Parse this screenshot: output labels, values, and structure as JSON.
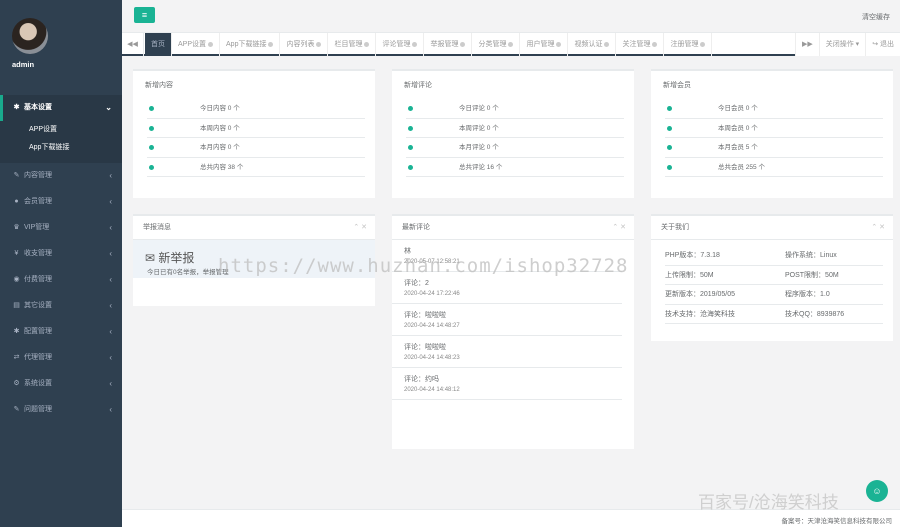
{
  "sidebar": {
    "username": "admin",
    "items": [
      {
        "icon": "gear-icon",
        "glyph": "✱",
        "label": "基本设置",
        "active": true,
        "chevron": "⌄"
      },
      {
        "icon": "edit-icon",
        "glyph": "✎",
        "label": "内容管理",
        "chevron": "‹"
      },
      {
        "icon": "user-icon",
        "glyph": "●",
        "label": "会员管理",
        "chevron": "‹"
      },
      {
        "icon": "vip-icon",
        "glyph": "♛",
        "label": "VIP管理",
        "chevron": "‹"
      },
      {
        "icon": "money-icon",
        "glyph": "¥",
        "label": "收支管理",
        "chevron": "‹"
      },
      {
        "icon": "pay-icon",
        "glyph": "◉",
        "label": "付费管理",
        "chevron": "‹"
      },
      {
        "icon": "mail-icon",
        "glyph": "▤",
        "label": "其它设置",
        "chevron": "‹"
      },
      {
        "icon": "config-icon",
        "glyph": "✱",
        "label": "配置管理",
        "chevron": "‹"
      },
      {
        "icon": "agent-icon",
        "glyph": "⇄",
        "label": "代理管理",
        "chevron": "‹"
      },
      {
        "icon": "system-icon",
        "glyph": "⚙",
        "label": "系统设置",
        "chevron": "‹"
      },
      {
        "icon": "question-icon",
        "glyph": "✎",
        "label": "问题管理",
        "chevron": "‹"
      }
    ],
    "subitems": [
      "APP设置",
      "App下载链接"
    ]
  },
  "topbar": {
    "menu_icon": "≡",
    "right_text": "清空缓存"
  },
  "tabsbar": {
    "prev": "◀◀",
    "next": "▶▶",
    "tabs": [
      "首页",
      "APP设置",
      "App下载链接",
      "内容列表",
      "栏目管理",
      "评论管理",
      "举报管理",
      "分类管理",
      "用户管理",
      "视频认证",
      "关注管理",
      "注册管理"
    ],
    "close_ops": "关闭操作 ▾",
    "logout": "↪ 退出"
  },
  "stats": [
    {
      "title": "新增内容",
      "rows": [
        "今日内容 0 个",
        "本周内容 0 个",
        "本月内容 0 个",
        "总共内容 38 个"
      ]
    },
    {
      "title": "新增评论",
      "rows": [
        "今日评论 0 个",
        "本周评论 0 个",
        "本月评论 0 个",
        "总共评论 16 个"
      ]
    },
    {
      "title": "新增会员",
      "rows": [
        "今日会员 0 个",
        "本周会员 0 个",
        "本月会员 5 个",
        "总共会员 255 个"
      ]
    }
  ],
  "report": {
    "title": "举报消息",
    "tools": "⌃ ✕",
    "head": "✉ 新举报",
    "sub": "今日已有0名举报，举报管理"
  },
  "comments": {
    "title": "最新评论",
    "tools": "⌃ ✕",
    "items": [
      {
        "text": "林",
        "time": "2020-05-07 12:58:21"
      },
      {
        "text": "评论：2",
        "time": "2020-04-24 17:22:46"
      },
      {
        "text": "评论：啦啦啦",
        "time": "2020-04-24 14:48:27"
      },
      {
        "text": "评论：啦啦啦",
        "time": "2020-04-24 14:48:23"
      },
      {
        "text": "评论：约吗",
        "time": "2020-04-24 14:48:12"
      }
    ]
  },
  "about": {
    "title": "关于我们",
    "tools": "⌃ ✕",
    "rows": [
      [
        "PHP版本：7.3.18",
        "操作系统：Linux"
      ],
      [
        "上传限制：50M",
        "POST限制：50M"
      ],
      [
        "更新版本：2019/05/05",
        "程序版本：1.0"
      ],
      [
        "技术支持：沧海笑科技",
        "技术QQ：8939876"
      ]
    ]
  },
  "footer": {
    "text": "备案号：天津沧海笑信息科技有限公司"
  },
  "watermark": "https://www.huzhan.com/ishop32728",
  "watermark2": "百家号/沧海笑科技",
  "chat_badge": "☺",
  "colors": {
    "accent": "#1ab394",
    "sidebar": "#2f4050",
    "sidebar_dark": "#293846"
  }
}
